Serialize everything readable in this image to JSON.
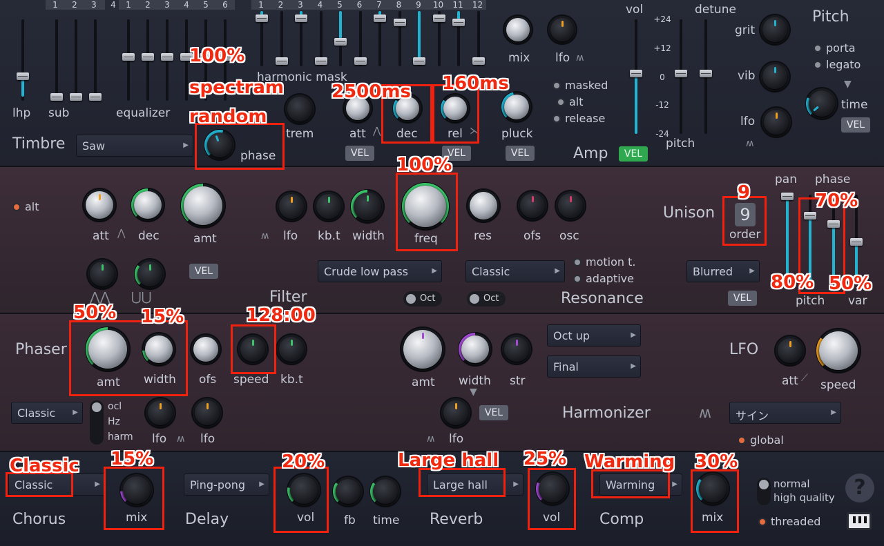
{
  "top": {
    "num_groups": {
      "hp": [
        "1",
        "2",
        "3",
        "4"
      ],
      "eq": [
        "1",
        "2",
        "3",
        "4",
        "5",
        "6"
      ],
      "harm": [
        "1",
        "2",
        "3",
        "4",
        "5",
        "6",
        "7",
        "8",
        "9",
        "10",
        "11",
        "12"
      ]
    },
    "lhp": "lhp",
    "sub": "sub",
    "equalizer": "equalizer",
    "harmonic_mask": "harmonic mask",
    "timbre": "Timbre",
    "timbre_value": "Saw",
    "phase": "phase",
    "trem": "trem",
    "att": "att",
    "dec": "dec",
    "rel": "rel",
    "pluck": "pluck",
    "mix": "mix",
    "lfo": "lfo",
    "masked": "masked",
    "alt": "alt",
    "release": "release",
    "amp": "Amp",
    "vel": "VEL",
    "vol": "vol",
    "detune": "detune",
    "scale": [
      "+24",
      "+12",
      "0",
      "-12",
      "-24"
    ],
    "pitch": "pitch",
    "grit": "grit",
    "vib": "vib",
    "pitch_title": "Pitch",
    "porta": "porta",
    "legato": "legato",
    "time": "time"
  },
  "filter": {
    "alt": "alt",
    "att": "att",
    "dec": "dec",
    "amt": "amt",
    "lfo": "lfo",
    "kbt": "kb.t",
    "width": "width",
    "freq": "freq",
    "res": "res",
    "ofs": "ofs",
    "osc": "osc",
    "vel": "VEL",
    "filter_title": "Filter",
    "type": "Crude low pass",
    "mode": "Classic",
    "oct": "Oct",
    "motion": "motion t.",
    "adaptive": "adaptive",
    "resonance": "Resonance",
    "unison": "Unison",
    "order_value": "9",
    "order": "order",
    "unison_mode": "Blurred",
    "pan": "pan",
    "phase": "phase",
    "pitch": "pitch",
    "var": "var"
  },
  "phaser": {
    "title": "Phaser",
    "amt": "amt",
    "width": "width",
    "ofs": "ofs",
    "speed": "speed",
    "kbt": "kb.t",
    "mode": "Classic",
    "ocl": "ocl",
    "hz": "Hz",
    "harm": "harm",
    "lfo": "lfo",
    "h_amt": "amt",
    "h_width": "width",
    "h_str": "str",
    "oct_up": "Oct up",
    "final": "Final",
    "harmonizer": "Harmonizer",
    "vel": "VEL",
    "lfo_title": "LFO",
    "att": "att",
    "lfo_speed": "speed",
    "wave": "サイン",
    "global": "global"
  },
  "fx": {
    "chorus_mode": "Classic",
    "mix": "mix",
    "chorus": "Chorus",
    "delay_mode": "Ping-pong",
    "vol": "vol",
    "fb": "fb",
    "time": "time",
    "delay": "Delay",
    "reverb_mode": "Large hall",
    "reverb": "Reverb",
    "comp_mode": "Warming",
    "comp": "Comp",
    "normal": "normal",
    "hq": "high quality",
    "threaded": "threaded",
    "help": "?"
  },
  "annotations": {
    "phase_1": "100%",
    "phase_2": "spectram",
    "phase_3": "random",
    "dec": "2500ms",
    "rel": "160ms",
    "freq": "100%",
    "order": "9",
    "phase_unison": "70%",
    "pitch_unison": "80%",
    "var_unison": "50%",
    "ph_amt": "50%",
    "ph_width": "15%",
    "ph_speed": "128:00",
    "chorus_mode": "Classic",
    "chorus_mix": "15%",
    "delay_vol": "20%",
    "reverb_mode": "Large hall",
    "reverb_vol": "25%",
    "comp_mode": "Warming",
    "comp_mix": "30%"
  },
  "colors": {
    "accent_cyan": "#22b3d0",
    "green": "#3cc46a",
    "purple": "#a44bd6",
    "orange": "#f0a021",
    "annotation": "#f0220f"
  }
}
